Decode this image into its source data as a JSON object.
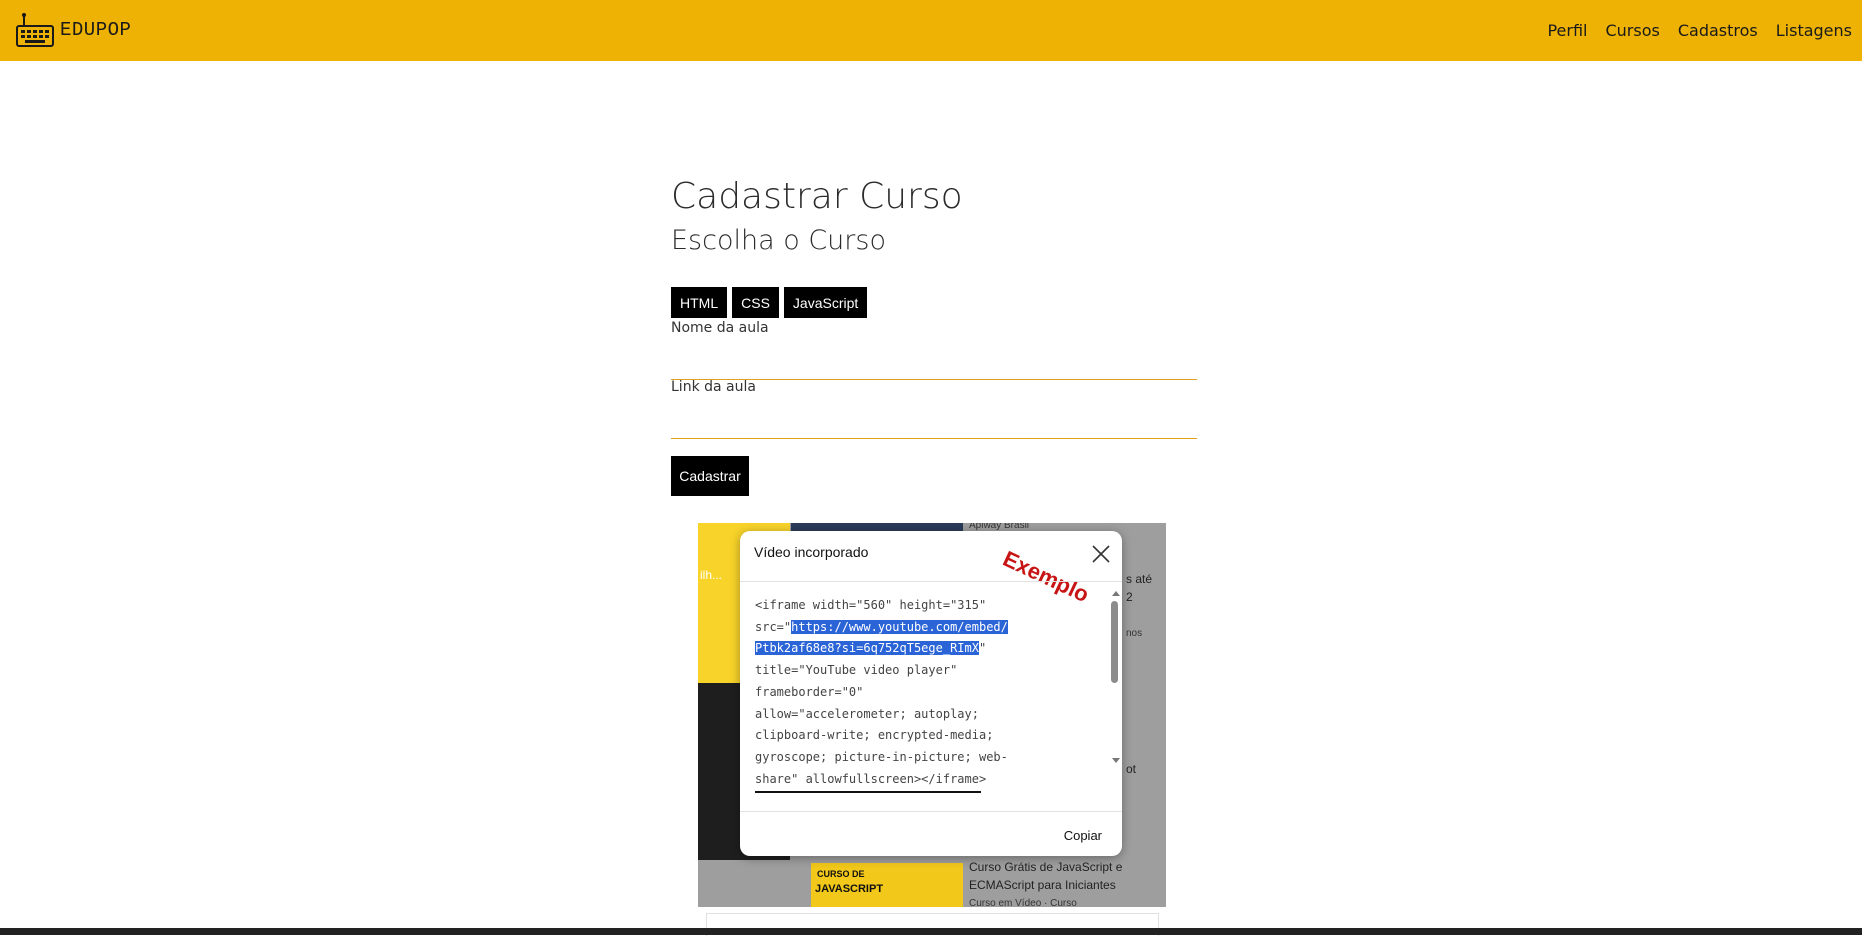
{
  "header": {
    "brand": "EDUPOP",
    "brand_icon": "keyboard-icon",
    "nav": [
      "Perfil",
      "Cursos",
      "Cadastros",
      "Listagens"
    ],
    "bg_color": "#EDB204"
  },
  "main": {
    "title": "Cadastrar Curso",
    "subtitle": "Escolha o Curso",
    "course_buttons": [
      "HTML",
      "CSS",
      "JavaScript"
    ],
    "lesson_name_label": "Nome da aula",
    "lesson_name_value": "",
    "lesson_link_label": "Link da aula",
    "lesson_link_value": "",
    "submit_label": "Cadastrar"
  },
  "example": {
    "dialog_title": "Vídeo incorporado",
    "stamp": "Exemplo",
    "code_before": "<iframe width=\"560\" height=\"315\"\nsrc=\"",
    "code_highlight": "https://www.youtube.com/embed/\nPtbk2af68e8?si=6q752qT5ege_RImX",
    "code_after": "\"\ntitle=\"YouTube video player\"\nframeborder=\"0\"\nallow=\"accelerometer; autoplay;\nclipboard-write; encrypted-media;\ngyroscope; picture-in-picture; web-\nshare\" allowfullscreen></iframe>",
    "copy_label": "Copiar",
    "background_texts": {
      "top_fragment": "Apiway Brasil",
      "left_fragment": "ilh...",
      "right_fragment_1": "s até",
      "right_fragment_2": "2",
      "right_fragment_3": "nos",
      "right_fragment_4": "ot",
      "card_title": "Curso Grátis de JavaScript e ECMAScript para Iniciantes",
      "card_channel": "Curso em Vídeo · Curso",
      "thumb_label_1": "CURSO DE",
      "thumb_label_2": "JAVASCRIPT"
    }
  }
}
